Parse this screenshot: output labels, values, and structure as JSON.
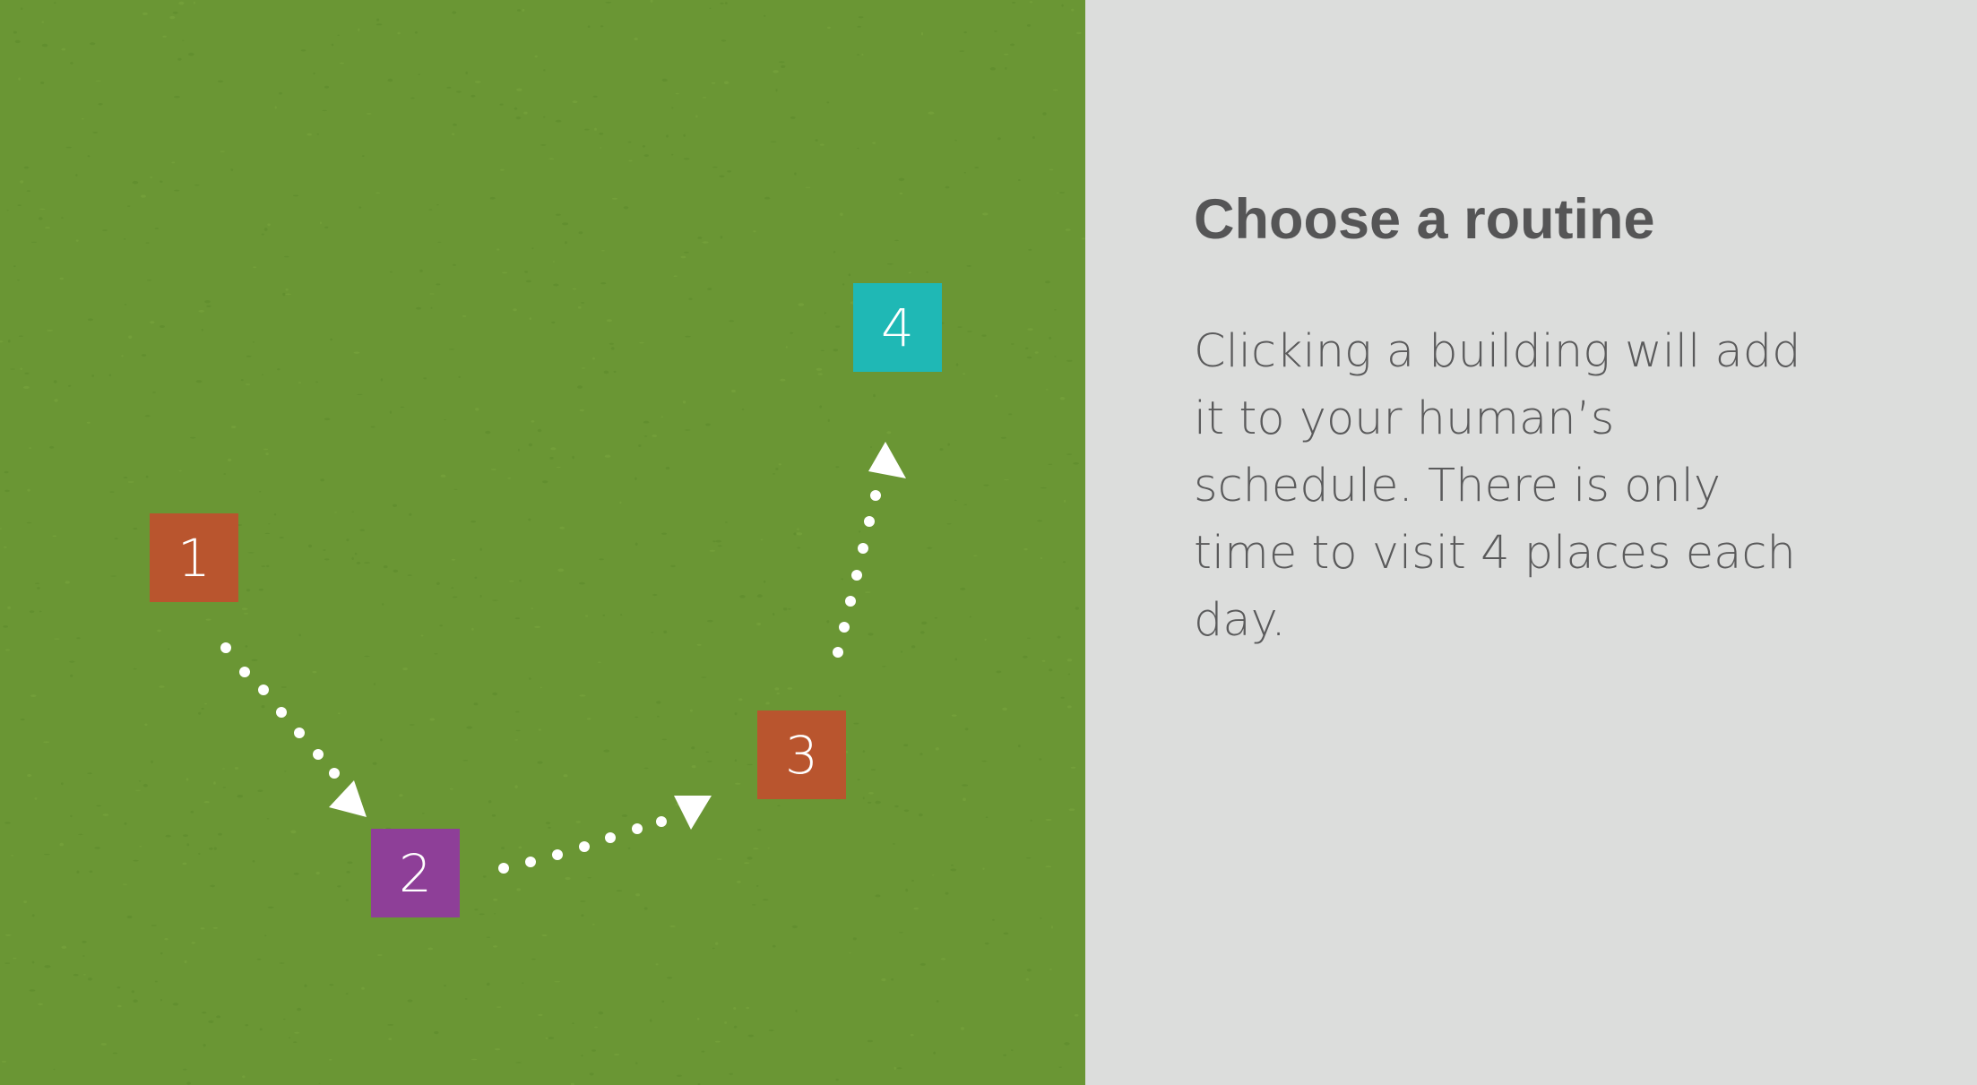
{
  "game": {
    "colors": {
      "grass": "#6a9634",
      "panel": "#dcdddc",
      "orange_building": "#b9552e",
      "purple_building": "#8e3f98",
      "teal_building": "#1fb8b5",
      "path": "#ffffff",
      "text": "#555556"
    },
    "buildings": [
      {
        "label": "1",
        "color": "#b9552e"
      },
      {
        "label": "2",
        "color": "#8e3f98"
      },
      {
        "label": "3",
        "color": "#b9552e"
      },
      {
        "label": "4",
        "color": "#1fb8b5"
      }
    ],
    "route_icons": [
      "dotted-path-arrow",
      "dotted-path-arrow",
      "dotted-path-arrow"
    ]
  },
  "instructions": {
    "title": "Choose a routine",
    "body": "Clicking a building will add it to your human’s schedule. There is only time to visit 4 places each day."
  }
}
